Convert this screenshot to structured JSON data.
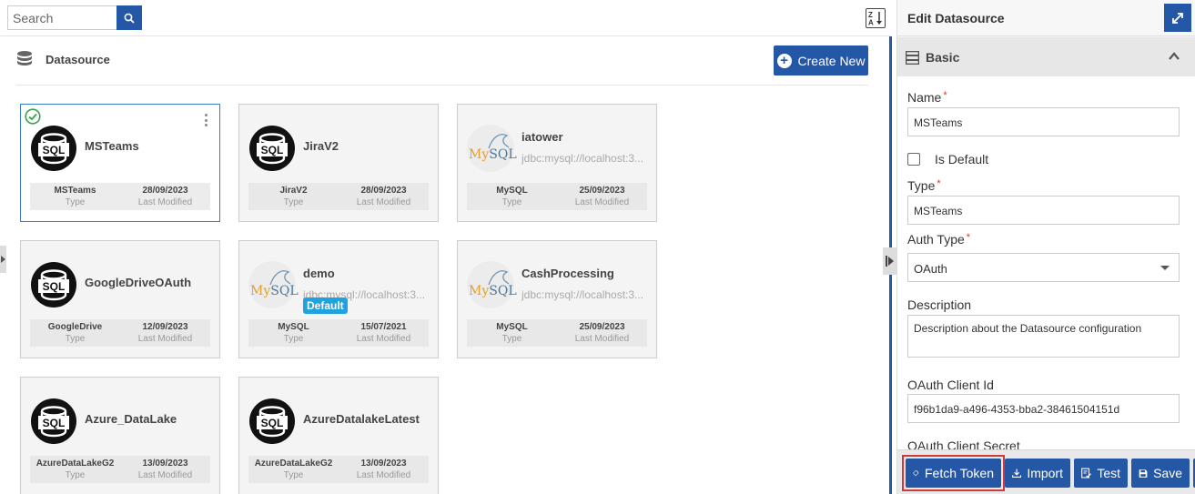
{
  "search": {
    "placeholder": "Search"
  },
  "toolbar": {
    "sort_icon": "sort-alpha-icon"
  },
  "section": {
    "title": "Datasource",
    "create_label": "Create New"
  },
  "cards": [
    {
      "name": "MSTeams",
      "type": "MSTeams",
      "date": "28/09/2023",
      "type_label": "Type",
      "date_label": "Last Modified",
      "logo": "sql"
    },
    {
      "name": "JiraV2",
      "type": "JiraV2",
      "date": "28/09/2023",
      "type_label": "Type",
      "date_label": "Last Modified",
      "logo": "sql"
    },
    {
      "name": "iatower",
      "url": "jdbc:mysql://localhost:3...",
      "type": "MySQL",
      "date": "25/09/2023",
      "type_label": "Type",
      "date_label": "Last Modified",
      "logo": "mysql"
    },
    {
      "name": "GoogleDriveOAuth",
      "type": "GoogleDrive",
      "date": "12/09/2023",
      "type_label": "Type",
      "date_label": "Last Modified",
      "logo": "sql"
    },
    {
      "name": "demo",
      "url": "jdbc:mysql://localhost:3...",
      "badge": "Default",
      "type": "MySQL",
      "date": "15/07/2021",
      "type_label": "Type",
      "date_label": "Last Modified",
      "logo": "mysql"
    },
    {
      "name": "CashProcessing",
      "url": "jdbc:mysql://localhost:3...",
      "type": "MySQL",
      "date": "25/09/2023",
      "type_label": "Type",
      "date_label": "Last Modified",
      "logo": "mysql"
    },
    {
      "name": "Azure_DataLake",
      "type": "AzureDataLakeG2",
      "date": "13/09/2023",
      "type_label": "Type",
      "date_label": "Last Modified",
      "logo": "sql"
    },
    {
      "name": "AzureDatalakeLatest",
      "type": "AzureDataLakeG2",
      "date": "13/09/2023",
      "type_label": "Type",
      "date_label": "Last Modified",
      "logo": "sql"
    }
  ],
  "logo_text": {
    "sql": "SQL",
    "my": "My",
    "sqlm": "SQL"
  },
  "panel": {
    "title": "Edit Datasource",
    "section": "Basic",
    "name_label": "Name",
    "name_value": "MSTeams",
    "is_default_label": "Is Default",
    "type_label": "Type",
    "type_value": "MSTeams",
    "auth_type_label": "Auth Type",
    "auth_type_value": "OAuth",
    "description_label": "Description",
    "description_value": "Description about the Datasource configuration",
    "client_id_label": "OAuth Client Id",
    "client_id_value": "f96b1da9-a496-4353-bba2-38461504151d",
    "client_secret_label": "OAuth Client Secret",
    "required_mark": "*"
  },
  "actions": {
    "fetch_token": "Fetch Token",
    "import": "Import",
    "test": "Test",
    "save": "Save"
  },
  "colors": {
    "primary": "#2557a7",
    "badge": "#1fa2dd",
    "check": "#3aa34a",
    "highlight": "#d13a3a"
  }
}
